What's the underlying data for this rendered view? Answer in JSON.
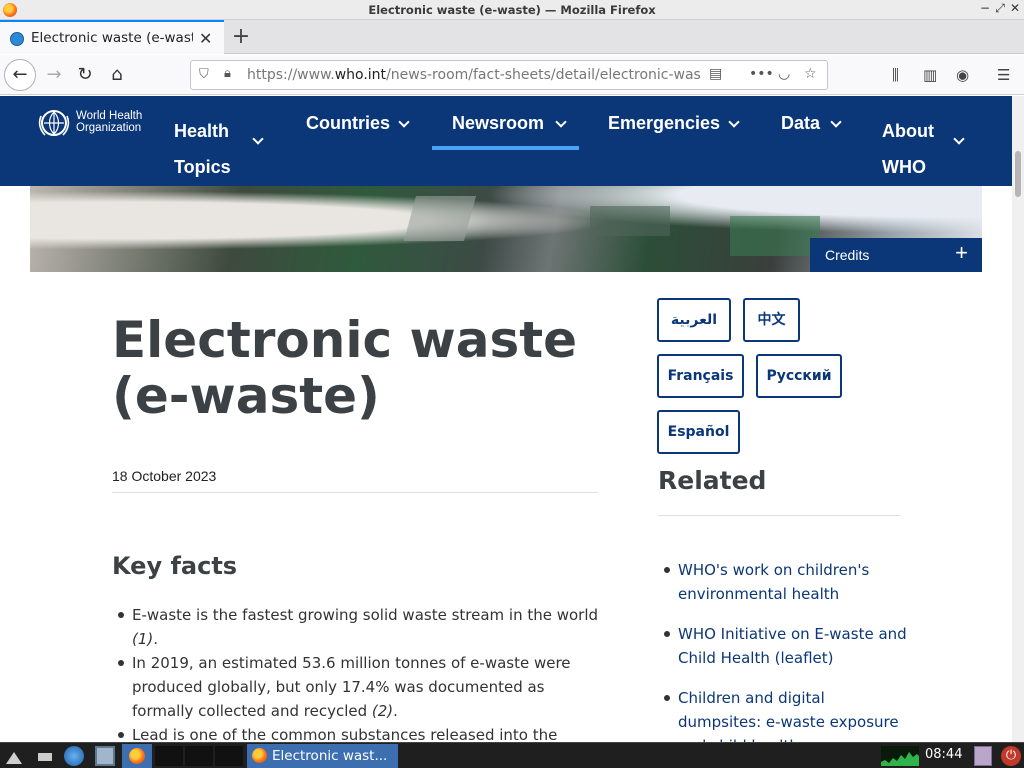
{
  "window": {
    "title": "Electronic waste (e-waste) — Mozilla Firefox",
    "controls": [
      "−",
      "⤢",
      "✕"
    ]
  },
  "tabs": [
    {
      "label": "Electronic waste (e-waste)"
    }
  ],
  "urlbar": {
    "prefix": "https://www.",
    "domain": "who.int",
    "path": "/news-room/fact-sheets/detail/electronic-waste-(e-waste)"
  },
  "site": {
    "logo_text": [
      "World Health",
      "Organization"
    ],
    "menu": [
      {
        "label": "Health Topics",
        "line1": "Health",
        "line2": "Topics"
      },
      {
        "label": "Countries"
      },
      {
        "label": "Newsroom"
      },
      {
        "label": "Emergencies"
      },
      {
        "label": "Data"
      },
      {
        "label": "About WHO",
        "line1": "About",
        "line2": "WHO"
      }
    ],
    "active_menu": "Newsroom"
  },
  "hero": {
    "credits_label": "Credits",
    "credits_icon": "plus-icon"
  },
  "article": {
    "title": "Electronic waste (e-waste)",
    "date": "18 October 2023",
    "key_facts_heading": "Key facts",
    "key_facts": [
      {
        "text": "E-waste is the fastest growing solid waste stream in the world ",
        "ref": "(1)",
        "tail": "."
      },
      {
        "text": "In 2019, an estimated 53.6 million tonnes of e-waste were produced globally, but only 17.4% was documented as formally collected and recycled ",
        "ref": "(2)",
        "tail": "."
      },
      {
        "text": "Lead is one of the common substances released into the",
        "ref": "",
        "tail": ""
      }
    ]
  },
  "languages": [
    "العربية",
    "中文",
    "Français",
    "Русский",
    "Español"
  ],
  "related": {
    "heading": "Related",
    "links": [
      "WHO's work on children's environmental health",
      "WHO Initiative on E-waste and Child Health (leaflet)",
      "Children and digital dumpsites: e-waste exposure and child health"
    ]
  },
  "taskbar": {
    "active_task": "Electronic wast...",
    "clock": "08:44"
  },
  "colors": {
    "who_blue": "#0b3778",
    "accent_underline": "#4aa3f2",
    "firefox_tab_accent": "#0a84ff"
  }
}
